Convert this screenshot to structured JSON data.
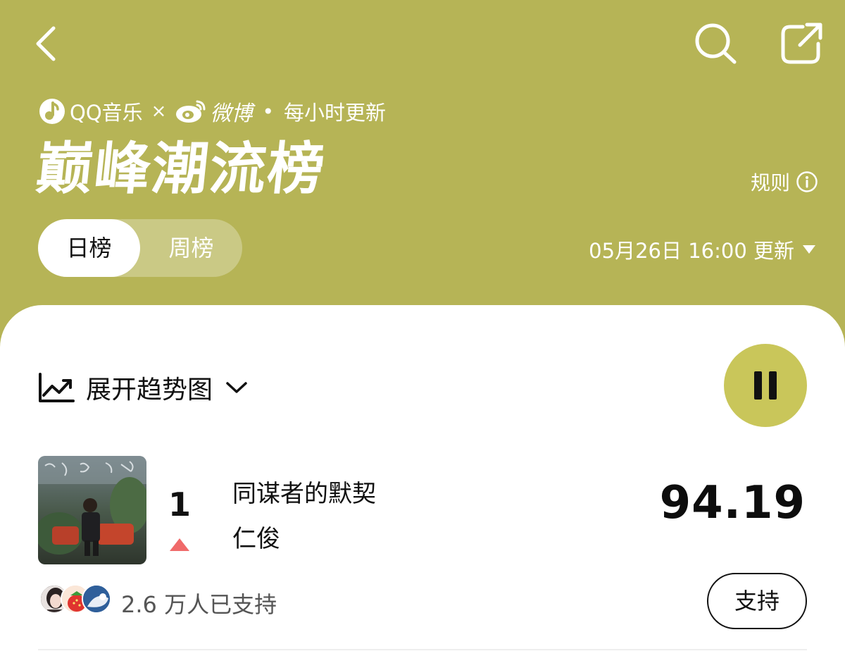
{
  "nav": {
    "back_icon": "chevron-left-icon",
    "search_icon": "search-icon",
    "share_icon": "share-icon"
  },
  "brand": {
    "partner1": "QQ音乐",
    "separator": "×",
    "partner2": "微博",
    "dot": "•",
    "frequency": "每小时更新"
  },
  "header": {
    "title": "巅峰潮流榜",
    "rules_label": "规则",
    "rules_icon": "info-icon",
    "background_color": "#b6b456"
  },
  "tabs": [
    {
      "label": "日榜",
      "selected": true
    },
    {
      "label": "周榜",
      "selected": false
    }
  ],
  "update": {
    "text": "05月26日 16:00 更新",
    "icon": "caret-down-icon"
  },
  "trend": {
    "label": "展开趋势图",
    "icon": "trend-chart-icon",
    "chevron_icon": "chevron-down-icon"
  },
  "player": {
    "state_icon": "pause-icon",
    "accent_color": "#c9c65a"
  },
  "songs": [
    {
      "rank": "1",
      "trend": "up",
      "trend_color": "#f06a6a",
      "title": "同谋者的默契",
      "artist": "仁俊",
      "score": "94.19",
      "supporters": "2.6 万人已支持",
      "support_button": "支持"
    }
  ]
}
